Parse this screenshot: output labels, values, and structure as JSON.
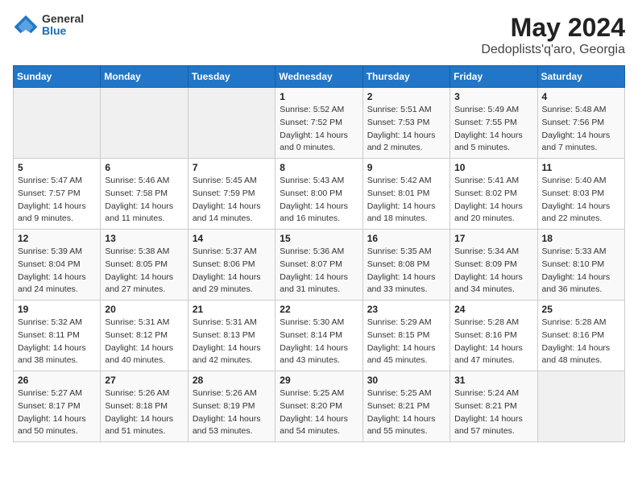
{
  "header": {
    "logo_general": "General",
    "logo_blue": "Blue",
    "month_title": "May 2024",
    "location": "Dedoplists'q'aro, Georgia"
  },
  "days_of_week": [
    "Sunday",
    "Monday",
    "Tuesday",
    "Wednesday",
    "Thursday",
    "Friday",
    "Saturday"
  ],
  "weeks": [
    [
      {
        "day": "",
        "info": ""
      },
      {
        "day": "",
        "info": ""
      },
      {
        "day": "",
        "info": ""
      },
      {
        "day": "1",
        "info": "Sunrise: 5:52 AM\nSunset: 7:52 PM\nDaylight: 14 hours and 0 minutes."
      },
      {
        "day": "2",
        "info": "Sunrise: 5:51 AM\nSunset: 7:53 PM\nDaylight: 14 hours and 2 minutes."
      },
      {
        "day": "3",
        "info": "Sunrise: 5:49 AM\nSunset: 7:55 PM\nDaylight: 14 hours and 5 minutes."
      },
      {
        "day": "4",
        "info": "Sunrise: 5:48 AM\nSunset: 7:56 PM\nDaylight: 14 hours and 7 minutes."
      }
    ],
    [
      {
        "day": "5",
        "info": "Sunrise: 5:47 AM\nSunset: 7:57 PM\nDaylight: 14 hours and 9 minutes."
      },
      {
        "day": "6",
        "info": "Sunrise: 5:46 AM\nSunset: 7:58 PM\nDaylight: 14 hours and 11 minutes."
      },
      {
        "day": "7",
        "info": "Sunrise: 5:45 AM\nSunset: 7:59 PM\nDaylight: 14 hours and 14 minutes."
      },
      {
        "day": "8",
        "info": "Sunrise: 5:43 AM\nSunset: 8:00 PM\nDaylight: 14 hours and 16 minutes."
      },
      {
        "day": "9",
        "info": "Sunrise: 5:42 AM\nSunset: 8:01 PM\nDaylight: 14 hours and 18 minutes."
      },
      {
        "day": "10",
        "info": "Sunrise: 5:41 AM\nSunset: 8:02 PM\nDaylight: 14 hours and 20 minutes."
      },
      {
        "day": "11",
        "info": "Sunrise: 5:40 AM\nSunset: 8:03 PM\nDaylight: 14 hours and 22 minutes."
      }
    ],
    [
      {
        "day": "12",
        "info": "Sunrise: 5:39 AM\nSunset: 8:04 PM\nDaylight: 14 hours and 24 minutes."
      },
      {
        "day": "13",
        "info": "Sunrise: 5:38 AM\nSunset: 8:05 PM\nDaylight: 14 hours and 27 minutes."
      },
      {
        "day": "14",
        "info": "Sunrise: 5:37 AM\nSunset: 8:06 PM\nDaylight: 14 hours and 29 minutes."
      },
      {
        "day": "15",
        "info": "Sunrise: 5:36 AM\nSunset: 8:07 PM\nDaylight: 14 hours and 31 minutes."
      },
      {
        "day": "16",
        "info": "Sunrise: 5:35 AM\nSunset: 8:08 PM\nDaylight: 14 hours and 33 minutes."
      },
      {
        "day": "17",
        "info": "Sunrise: 5:34 AM\nSunset: 8:09 PM\nDaylight: 14 hours and 34 minutes."
      },
      {
        "day": "18",
        "info": "Sunrise: 5:33 AM\nSunset: 8:10 PM\nDaylight: 14 hours and 36 minutes."
      }
    ],
    [
      {
        "day": "19",
        "info": "Sunrise: 5:32 AM\nSunset: 8:11 PM\nDaylight: 14 hours and 38 minutes."
      },
      {
        "day": "20",
        "info": "Sunrise: 5:31 AM\nSunset: 8:12 PM\nDaylight: 14 hours and 40 minutes."
      },
      {
        "day": "21",
        "info": "Sunrise: 5:31 AM\nSunset: 8:13 PM\nDaylight: 14 hours and 42 minutes."
      },
      {
        "day": "22",
        "info": "Sunrise: 5:30 AM\nSunset: 8:14 PM\nDaylight: 14 hours and 43 minutes."
      },
      {
        "day": "23",
        "info": "Sunrise: 5:29 AM\nSunset: 8:15 PM\nDaylight: 14 hours and 45 minutes."
      },
      {
        "day": "24",
        "info": "Sunrise: 5:28 AM\nSunset: 8:16 PM\nDaylight: 14 hours and 47 minutes."
      },
      {
        "day": "25",
        "info": "Sunrise: 5:28 AM\nSunset: 8:16 PM\nDaylight: 14 hours and 48 minutes."
      }
    ],
    [
      {
        "day": "26",
        "info": "Sunrise: 5:27 AM\nSunset: 8:17 PM\nDaylight: 14 hours and 50 minutes."
      },
      {
        "day": "27",
        "info": "Sunrise: 5:26 AM\nSunset: 8:18 PM\nDaylight: 14 hours and 51 minutes."
      },
      {
        "day": "28",
        "info": "Sunrise: 5:26 AM\nSunset: 8:19 PM\nDaylight: 14 hours and 53 minutes."
      },
      {
        "day": "29",
        "info": "Sunrise: 5:25 AM\nSunset: 8:20 PM\nDaylight: 14 hours and 54 minutes."
      },
      {
        "day": "30",
        "info": "Sunrise: 5:25 AM\nSunset: 8:21 PM\nDaylight: 14 hours and 55 minutes."
      },
      {
        "day": "31",
        "info": "Sunrise: 5:24 AM\nSunset: 8:21 PM\nDaylight: 14 hours and 57 minutes."
      },
      {
        "day": "",
        "info": ""
      }
    ]
  ]
}
